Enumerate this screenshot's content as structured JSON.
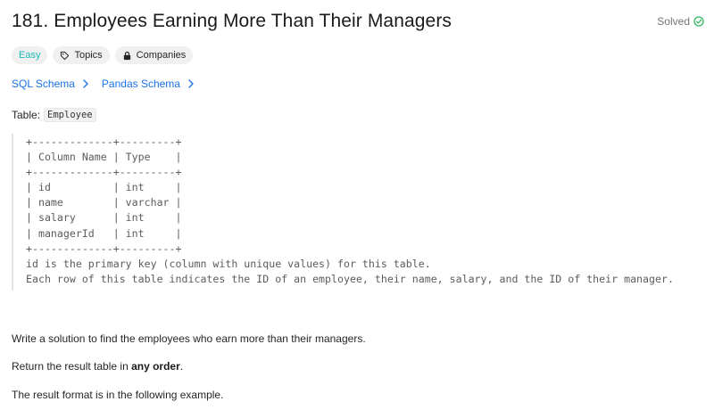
{
  "problem": {
    "title": "181. Employees Earning More Than Their Managers",
    "status": "Solved"
  },
  "tags": {
    "difficulty": "Easy",
    "topics": "Topics",
    "companies": "Companies"
  },
  "schemas": {
    "sql": "SQL Schema",
    "pandas": "Pandas Schema"
  },
  "table_intro": {
    "label": "Table:",
    "name": "Employee"
  },
  "schema_block": {
    "lines": [
      "+-------------+---------+",
      "| Column Name | Type    |",
      "+-------------+---------+",
      "| id          | int     |",
      "| name        | varchar |",
      "| salary      | int     |",
      "| managerId   | int     |",
      "+-------------+---------+",
      "id is the primary key (column with unique values) for this table.",
      "Each row of this table indicates the ID of an employee, their name, salary, and the ID of their manager."
    ]
  },
  "description": {
    "task": "Write a solution to find the employees who earn more than their managers.",
    "return_prefix": "Return the result table in ",
    "return_bold": "any order",
    "return_suffix": ".",
    "format_note": "The result format is in the following example."
  },
  "colors": {
    "easy": "#1cb8b8",
    "link": "#1a73e8",
    "solved_check": "#2cbb5d"
  },
  "icons": {
    "solved": "check-circle-icon",
    "topics": "tag-icon",
    "companies": "lock-icon",
    "schema_arrow": "chevron-right-icon"
  }
}
